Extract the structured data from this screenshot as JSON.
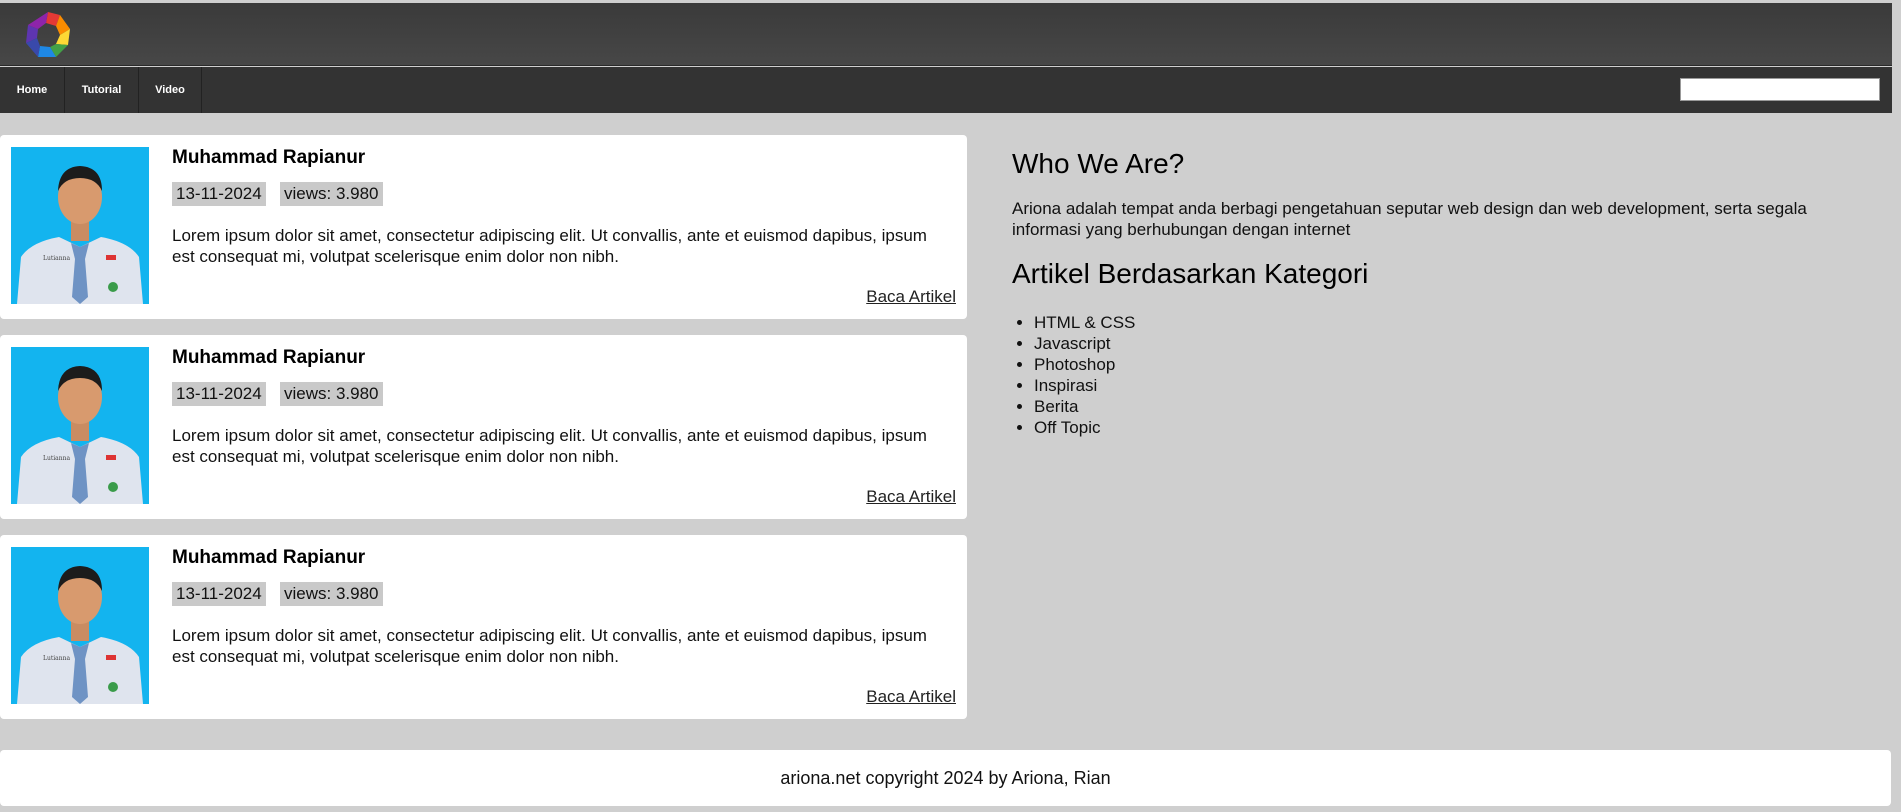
{
  "header": {
    "logo_icon": "hexagon-swirl-logo"
  },
  "nav": {
    "items": [
      {
        "label": "Home"
      },
      {
        "label": "Tutorial"
      },
      {
        "label": "Video"
      }
    ],
    "search": {
      "value": "",
      "placeholder": ""
    }
  },
  "articles": [
    {
      "author": "Muhammad Rapianur",
      "date": "13-11-2024",
      "views": "views: 3.980",
      "excerpt": "Lorem ipsum dolor sit amet, consectetur adipiscing elit. Ut convallis, ante et euismod dapibus, ipsum est consequat mi, volutpat scelerisque enim dolor non nibh.",
      "link": "Baca Artikel"
    },
    {
      "author": "Muhammad Rapianur",
      "date": "13-11-2024",
      "views": "views: 3.980",
      "excerpt": "Lorem ipsum dolor sit amet, consectetur adipiscing elit. Ut convallis, ante et euismod dapibus, ipsum est consequat mi, volutpat scelerisque enim dolor non nibh.",
      "link": "Baca Artikel"
    },
    {
      "author": "Muhammad Rapianur",
      "date": "13-11-2024",
      "views": "views: 3.980",
      "excerpt": "Lorem ipsum dolor sit amet, consectetur adipiscing elit. Ut convallis, ante et euismod dapibus, ipsum est consequat mi, volutpat scelerisque enim dolor non nibh.",
      "link": "Baca Artikel"
    }
  ],
  "sidebar": {
    "about_title": "Who We Are?",
    "about_text": "Ariona adalah tempat anda berbagi pengetahuan seputar web design dan web development, serta segala informasi yang berhubungan dengan internet",
    "categories_title": "Artikel Berdasarkan Kategori",
    "categories": [
      "HTML & CSS",
      "Javascript",
      "Photoshop",
      "Inspirasi",
      "Berita",
      "Off Topic"
    ]
  },
  "footer": {
    "text": "ariona.net copyright 2024 by Ariona, Rian"
  },
  "colors": {
    "page_bg": "#cfcfcf",
    "header_bg": "#444444",
    "nav_bg": "#333333",
    "photo_bg": "#13b4ef",
    "tag_bg": "#c9c9c9"
  }
}
